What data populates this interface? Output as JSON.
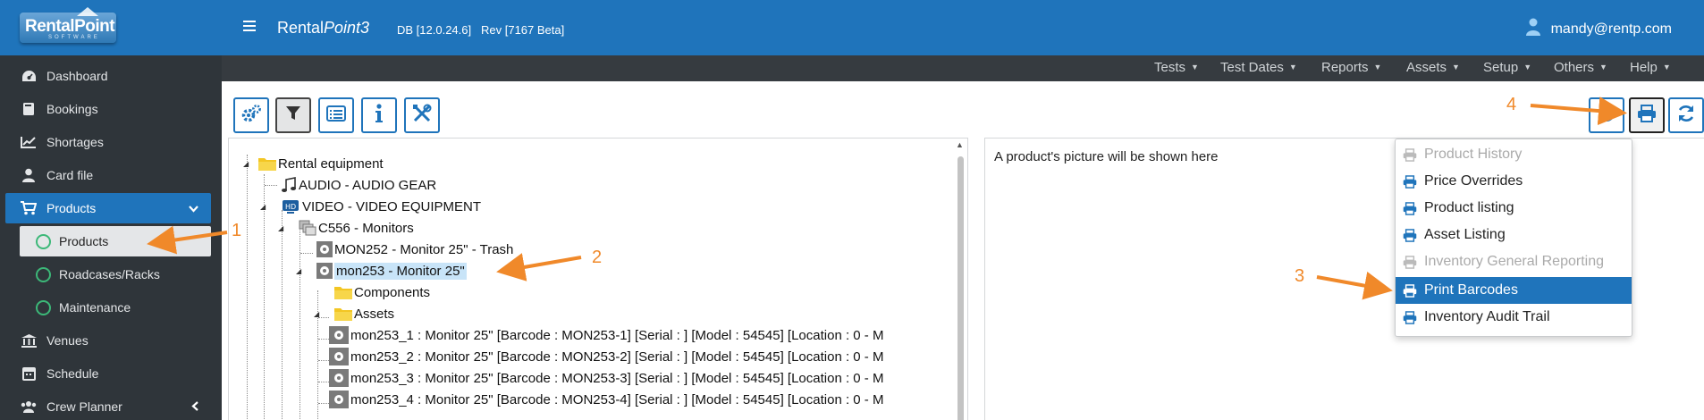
{
  "app": {
    "logo_text": "RentalPoint",
    "logo_sub": "SOFTWARE",
    "title_main": "Rental",
    "title_italic": "Point3",
    "db": "DB [12.0.24.6]",
    "rev": "Rev [7167 Beta]",
    "user": "mandy@rentp.com"
  },
  "menubar": [
    "Tests",
    "Test Dates",
    "Reports",
    "Assets",
    "Setup",
    "Others",
    "Help"
  ],
  "sidebar": {
    "items": [
      {
        "label": "Dashboard",
        "icon": "dashboard-icon"
      },
      {
        "label": "Bookings",
        "icon": "book-icon"
      },
      {
        "label": "Shortages",
        "icon": "chart-line-icon"
      },
      {
        "label": "Card file",
        "icon": "user-icon"
      },
      {
        "label": "Products",
        "icon": "cart-icon"
      },
      {
        "label": "Venues",
        "icon": "bank-icon"
      },
      {
        "label": "Schedule",
        "icon": "calendar-icon"
      },
      {
        "label": "Crew Planner",
        "icon": "users-icon"
      }
    ],
    "subitems": [
      "Products",
      "Roadcases/Racks",
      "Maintenance"
    ]
  },
  "tree": {
    "root": "Rental equipment",
    "audio": "AUDIO - AUDIO GEAR",
    "video": "VIDEO - VIDEO EQUIPMENT",
    "group": "C556 - Monitors",
    "mon252": "MON252 - Monitor 25\" - Trash",
    "mon253": "mon253 - Monitor 25\"",
    "components": "Components",
    "assets": "Assets",
    "asset_rows": [
      "mon253_1 : Monitor 25\" [Barcode : MON253-1] [Serial : ] [Model : 54545] [Location : 0 - M",
      "mon253_2 : Monitor 25\" [Barcode : MON253-2] [Serial : ] [Model : 54545] [Location : 0 - M",
      "mon253_3 : Monitor 25\" [Barcode : MON253-3] [Serial : ] [Model : 54545] [Location : 0 - M",
      "mon253_4 : Monitor 25\" [Barcode : MON253-4] [Serial : ] [Model : 54545] [Location : 0 - M"
    ]
  },
  "picture_panel": {
    "placeholder": "A product's picture will be shown here"
  },
  "print_menu": {
    "items": [
      {
        "label": "Product History",
        "state": "disabled"
      },
      {
        "label": "Price Overrides",
        "state": "enabled"
      },
      {
        "label": "Product listing",
        "state": "enabled"
      },
      {
        "label": "Asset Listing",
        "state": "enabled"
      },
      {
        "label": "Inventory General Reporting",
        "state": "disabled"
      },
      {
        "label": "Print Barcodes",
        "state": "highlighted"
      },
      {
        "label": "Inventory Audit Trail",
        "state": "enabled"
      }
    ]
  },
  "annotations": [
    "1",
    "2",
    "3",
    "4"
  ],
  "colors": {
    "brand_blue": "#1f74bb",
    "sidebar_bg": "#2f353a",
    "menubar_bg": "#363b40",
    "annotation_orange": "#f0892a",
    "tree_selection": "#c8e4f8"
  }
}
